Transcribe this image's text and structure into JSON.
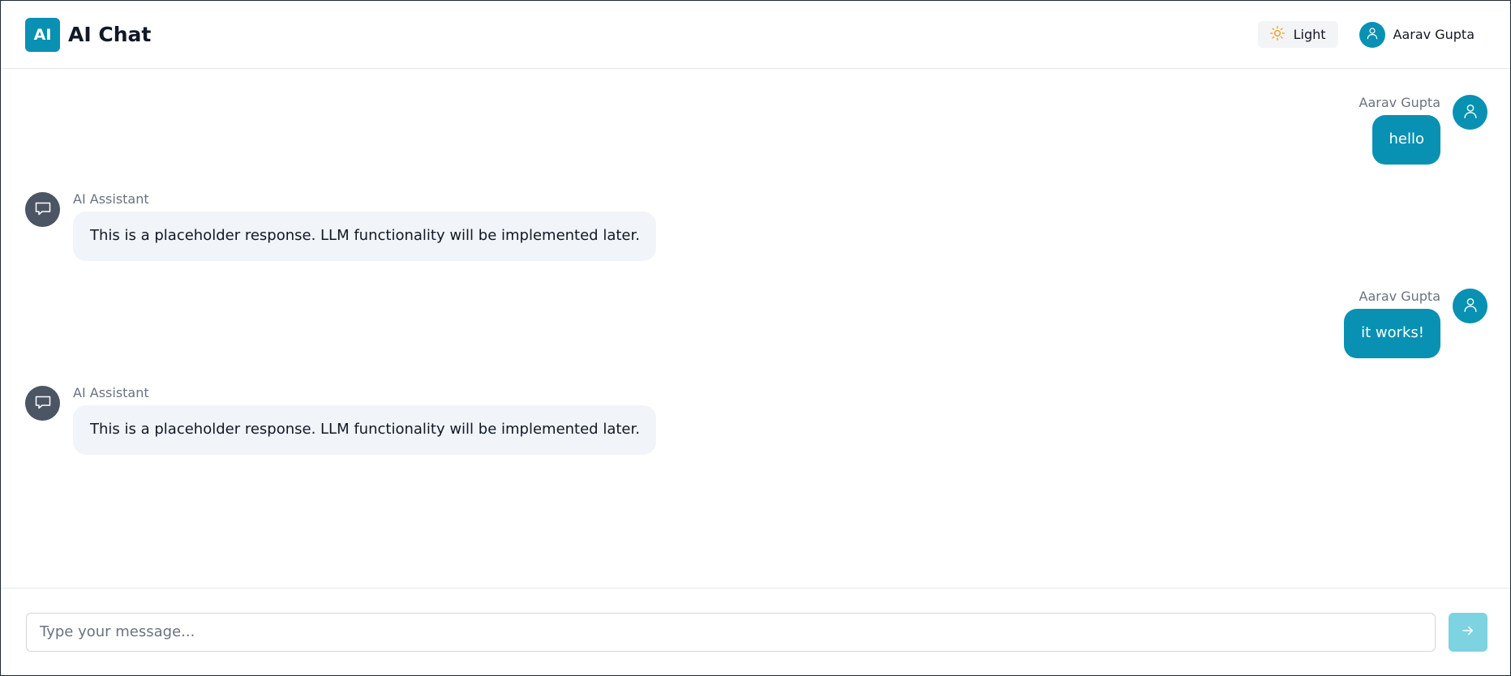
{
  "header": {
    "logo_text": "AI",
    "title": "AI Chat",
    "theme_label": "Light",
    "user_name": "Aarav Gupta"
  },
  "messages": [
    {
      "role": "user",
      "sender": "Aarav Gupta",
      "text": "hello"
    },
    {
      "role": "assistant",
      "sender": "AI Assistant",
      "text": "This is a placeholder response. LLM functionality will be implemented later."
    },
    {
      "role": "user",
      "sender": "Aarav Gupta",
      "text": "it works!"
    },
    {
      "role": "assistant",
      "sender": "AI Assistant",
      "text": "This is a placeholder response. LLM functionality will be implemented later."
    }
  ],
  "composer": {
    "placeholder": "Type your message...",
    "value": "",
    "send_icon": "arrow-right-icon"
  },
  "colors": {
    "accent": "#0891b2",
    "send_button": "#7dd3e0",
    "bot_bubble": "#f1f4f8",
    "bot_avatar": "#4b5563",
    "sun_icon": "#f59e0b"
  },
  "icons": {
    "theme": "sun-icon",
    "user": "user-icon",
    "assistant": "chat-bubble-icon"
  }
}
